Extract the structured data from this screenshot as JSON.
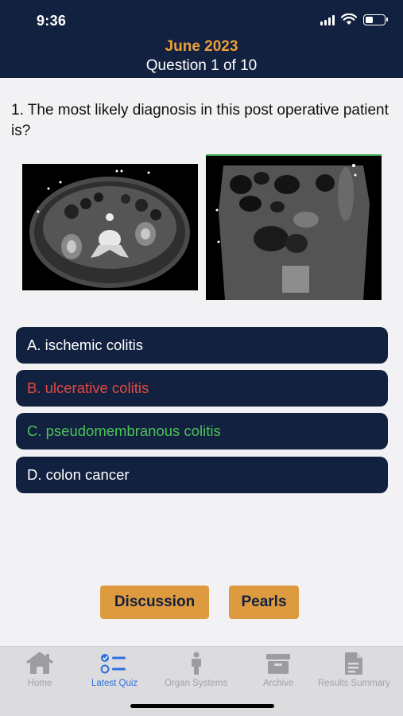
{
  "status_bar": {
    "time": "9:36"
  },
  "header": {
    "title": "June 2023",
    "subtitle": "Question 1 of 10"
  },
  "question": {
    "text": "1. The most likely diagnosis in this post operative patient is?"
  },
  "images": [
    {
      "name": "ct-axial-image"
    },
    {
      "name": "ct-coronal-image"
    }
  ],
  "options": [
    {
      "label": "A. ischemic colitis",
      "color": "#ffffff"
    },
    {
      "label": "B. ulcerative colitis",
      "color": "#e5493f"
    },
    {
      "label": "C. pseudomembranous colitis",
      "color": "#4cc25a"
    },
    {
      "label": "D. colon cancer",
      "color": "#ffffff"
    }
  ],
  "buttons": {
    "discussion": "Discussion",
    "pearls": "Pearls"
  },
  "tabs": [
    {
      "label": "Home",
      "icon": "home-icon",
      "active": false
    },
    {
      "label": "Latest Quiz",
      "icon": "checklist-icon",
      "active": true
    },
    {
      "label": "Organ Systems",
      "icon": "person-icon",
      "active": false
    },
    {
      "label": "Archive",
      "icon": "archive-box-icon",
      "active": false
    },
    {
      "label": "Results Summary",
      "icon": "document-icon",
      "active": false
    }
  ],
  "colors": {
    "navy": "#12213f",
    "accent": "#e9a03b",
    "button": "#dd9a3e",
    "active_tab": "#2e6fe0"
  }
}
